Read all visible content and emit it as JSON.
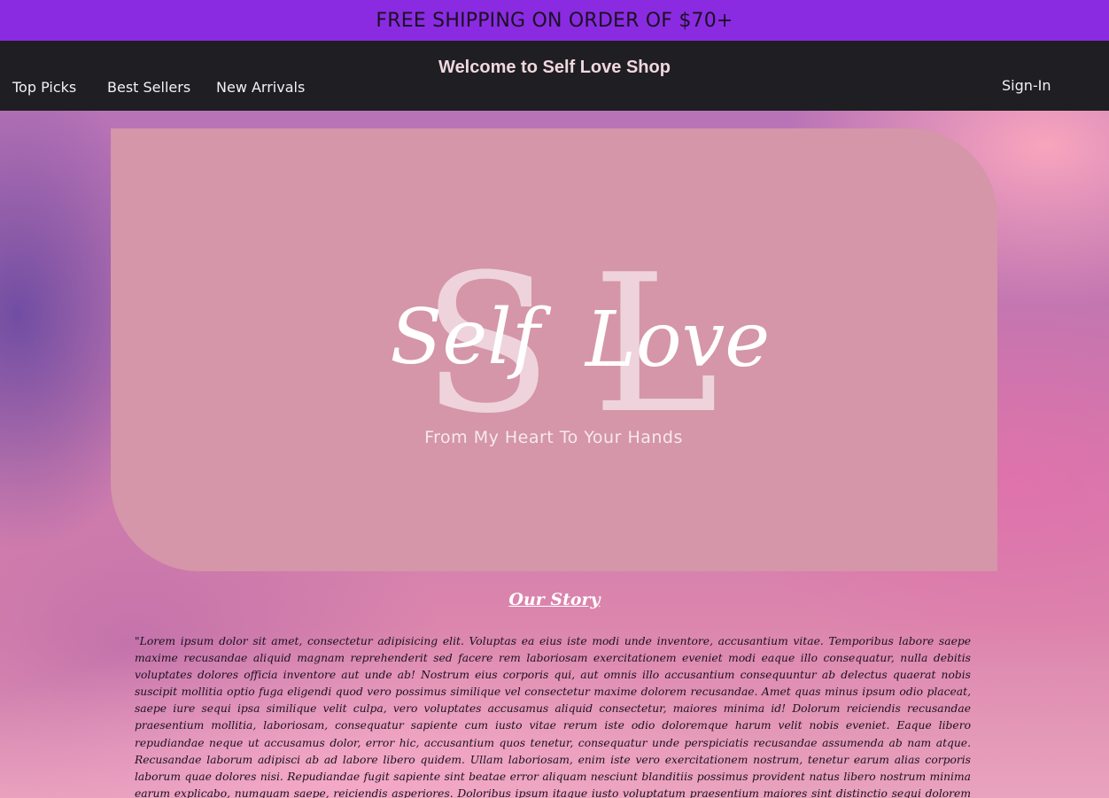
{
  "promo": {
    "text": "FREE SHIPPING ON ORDER OF $70+"
  },
  "header": {
    "title": "Welcome to Self Love Shop",
    "nav": [
      {
        "label": "Top Picks"
      },
      {
        "label": "Best Sellers"
      },
      {
        "label": "New Arrivals"
      }
    ],
    "signin_label": "Sign-In"
  },
  "hero": {
    "logo_monogram": "SL",
    "logo_word_left": "Self",
    "logo_word_right": "Love",
    "tagline": "From My Heart To Your Hands"
  },
  "story": {
    "title": "Our Story",
    "text": "\"Lorem ipsum dolor sit amet, consectetur adipisicing elit. Voluptas ea eius iste modi unde inventore, accusantium vitae. Temporibus labore saepe maxime recusandae aliquid magnam reprehenderit sed facere rem laboriosam exercitationem eveniet modi eaque illo consequatur, nulla debitis voluptates dolores officia inventore aut unde ab! Nostrum eius corporis qui, aut omnis illo accusantium consequuntur ab delectus quaerat nobis suscipit mollitia optio fuga eligendi quod vero possimus similique vel consectetur maxime dolorem recusandae. Amet quas minus ipsum odio placeat, saepe iure sequi ipsa similique velit culpa, vero voluptates accusamus aliquid consectetur, maiores minima id! Dolorum reiciendis recusandae praesentium mollitia, laboriosam, consequatur sapiente cum iusto vitae rerum iste odio doloremque harum velit nobis eveniet. Eaque libero repudiandae neque ut accusamus dolor, error hic, accusantium quos tenetur, consequatur unde perspiciatis recusandae assumenda ab nam atque. Recusandae laborum adipisci ab ad labore libero quidem. Ullam laboriosam, enim iste vero exercitationem nostrum, tenetur earum alias corporis laborum quae dolores nisi. Repudiandae fugit sapiente sint beatae error aliquam nesciunt blanditiis possimus provident natus libero nostrum minima earum explicabo, numquam saepe, reiciendis asperiores. Doloribus ipsum itaque iusto voluptatum praesentium maiores sint distinctio sequi dolorem rem? Aperiam excepturi fugit ab voluptatibus quaerat dicta consequatur iusto? Quas vitae eaque laborum molestiae dolores porro non molestias odit ipsum exercitationem! Vero quas rem quod delectus sit deserunt"
  },
  "colors": {
    "promo_bg": "#8a2be2",
    "nav_bg": "#1f1e23",
    "hero_bg": "#d496a8",
    "title_text": "#f0d7de"
  }
}
